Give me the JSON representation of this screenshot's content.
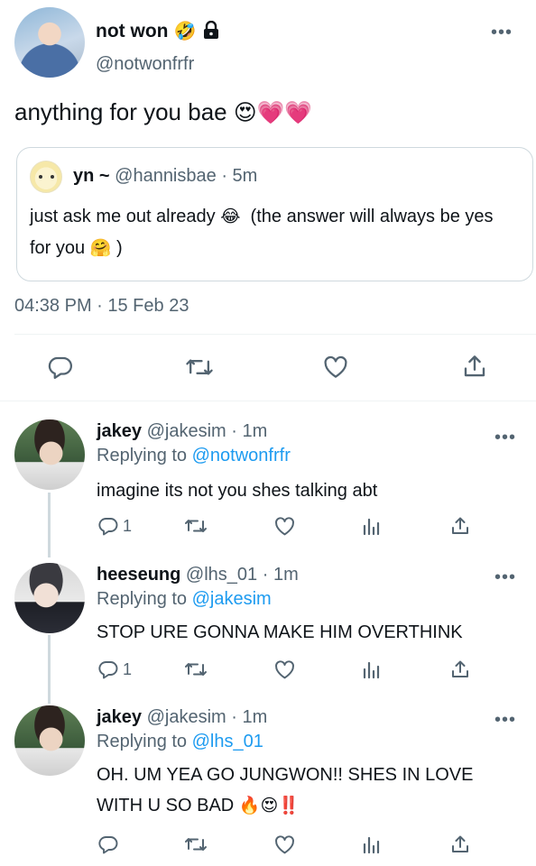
{
  "main_tweet": {
    "display_name": "not won",
    "name_emoji": "🤣",
    "handle": "@notwonfrfr",
    "text": "anything for you bae",
    "text_emoji": "😍💗💗",
    "quote": {
      "display_name": "yn ~",
      "handle": "@hannisbae",
      "time": "· 5m",
      "text_part1": "just ask me out already",
      "emoji1": "😂",
      "text_part2": "(the answer will always be yes for you",
      "emoji2": "🤗",
      "text_part3": ")"
    },
    "timestamp": "04:38 PM · 15 Feb 23"
  },
  "replies": [
    {
      "display_name": "jakey",
      "handle": "@jakesim",
      "time": "· 1m",
      "replying_label": "Replying to",
      "replying_to": "@notwonfrfr",
      "text": "imagine its not you shes talking abt",
      "text_emoji": "",
      "reply_count": "1"
    },
    {
      "display_name": "heeseung",
      "handle": "@lhs_01",
      "time": "· 1m",
      "replying_label": "Replying to",
      "replying_to": "@jakesim",
      "text": "STOP URE GONNA MAKE HIM OVERTHINK",
      "text_emoji": "",
      "reply_count": "1"
    },
    {
      "display_name": "jakey",
      "handle": "@jakesim",
      "time": "· 1m",
      "replying_label": "Replying to",
      "replying_to": "@lhs_01",
      "text": "OH. UM YEA GO JUNGWON!! SHES IN LOVE WITH U SO BAD",
      "text_emoji": "🔥😍‼️",
      "reply_count": ""
    }
  ],
  "icons": {
    "reply": "reply-icon",
    "retweet": "retweet-icon",
    "like": "heart-icon",
    "views": "views-icon",
    "share": "share-icon",
    "more": "more-icon",
    "lock": "lock-icon"
  },
  "colors": {
    "text": "#0f1419",
    "secondary": "#536471",
    "link": "#1d9bf0",
    "border": "#cfd9de"
  }
}
